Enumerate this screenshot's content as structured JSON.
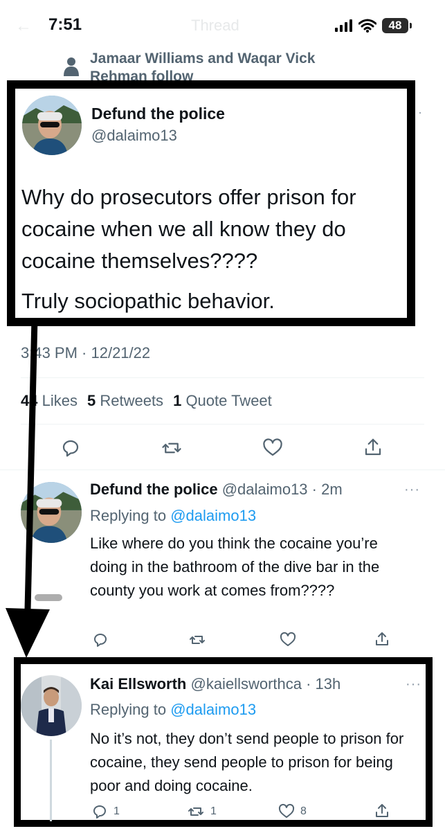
{
  "status_bar": {
    "time": "7:51",
    "battery": "48"
  },
  "header": {
    "title": "Thread"
  },
  "social_context": {
    "text": "Jamaar Williams and Waqar Vick Rehman follow"
  },
  "main_tweet": {
    "name": "Defund the police",
    "handle": "@dalaimo13",
    "body_lines": "Why do prosecutors offer prison for cocaine when we all know they do cocaine themselves????",
    "body_line2": "Truly sociopathic behavior.",
    "timestamp": "3:43 PM · 12/21/22",
    "likes_count": "44",
    "likes_label": "Likes",
    "retweets_count": "5",
    "retweets_label": "Retweets",
    "quotes_count": "1",
    "quotes_label": "Quote Tweet"
  },
  "reply1": {
    "name": "Defund the police",
    "handle": "@dalaimo13",
    "time": "· 2m",
    "replying_to_label": "Replying to",
    "replying_to": "@dalaimo13",
    "body": "Like where do you think the cocaine you’re doing in the bathroom of the dive bar in the county you work at comes from????"
  },
  "reply2": {
    "name": "Kai Ellsworth",
    "handle": "@kaiellsworthca",
    "time": "· 13h",
    "replying_to_label": "Replying to",
    "replying_to": "@dalaimo13",
    "body": "No it’s not, they don’t send people to prison for cocaine, they send people to prison for being poor and doing cocaine.",
    "reply_count": "1",
    "retweet_count": "1",
    "like_count": "8"
  },
  "icons": {
    "reply": "comment-icon",
    "retweet": "retweet-icon",
    "like": "heart-icon",
    "share": "share-icon",
    "more": "more-icon"
  },
  "colors": {
    "link": "#1d9bf0",
    "secondary": "#536471",
    "annotation": "#000000"
  }
}
